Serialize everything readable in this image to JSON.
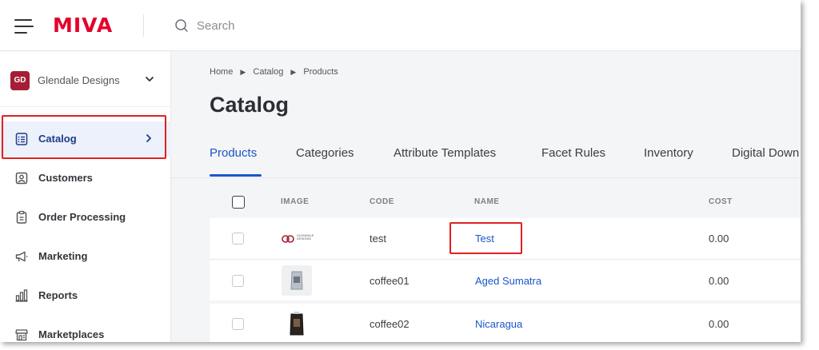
{
  "app": {
    "logo_text": "MIVA",
    "brand_color": "#e4002b",
    "accent_color": "#1a56c8",
    "highlight_color": "#e02020"
  },
  "search": {
    "placeholder": "Search"
  },
  "store": {
    "logo_text": "GD",
    "name": "Glendale Designs"
  },
  "sidebar": {
    "items": [
      {
        "label": "Catalog",
        "icon": "catalog-icon",
        "active": true
      },
      {
        "label": "Customers",
        "icon": "customers-icon",
        "active": false
      },
      {
        "label": "Order Processing",
        "icon": "clipboard-icon",
        "active": false
      },
      {
        "label": "Marketing",
        "icon": "megaphone-icon",
        "active": false
      },
      {
        "label": "Reports",
        "icon": "bar-chart-icon",
        "active": false
      },
      {
        "label": "Marketplaces",
        "icon": "storefront-icon",
        "active": false
      }
    ]
  },
  "breadcrumb": [
    "Home",
    "Catalog",
    "Products"
  ],
  "page": {
    "title": "Catalog"
  },
  "tabs": [
    {
      "label": "Products",
      "active": true
    },
    {
      "label": "Categories",
      "active": false
    },
    {
      "label": "Attribute Templates",
      "active": false
    },
    {
      "label": "Facet Rules",
      "active": false
    },
    {
      "label": "Inventory",
      "active": false
    },
    {
      "label": "Digital Down",
      "active": false
    }
  ],
  "table": {
    "columns": [
      "IMAGE",
      "CODE",
      "NAME",
      "COST"
    ],
    "rows": [
      {
        "image": "glendale-designs-logo",
        "image_text": "GLENDALE DESIGNS",
        "code": "test",
        "name": "Test",
        "cost": "0.00"
      },
      {
        "image": "coffee-bag-silver",
        "code": "coffee01",
        "name": "Aged Sumatra",
        "cost": "0.00"
      },
      {
        "image": "coffee-bag-black",
        "code": "coffee02",
        "name": "Nicaragua",
        "cost": "0.00"
      }
    ]
  }
}
